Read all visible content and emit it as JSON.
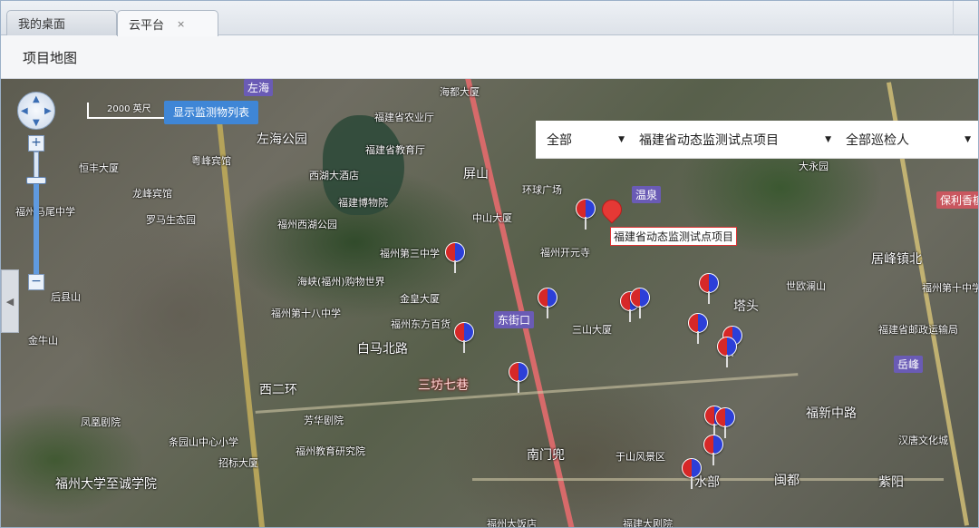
{
  "tabs": [
    {
      "label": "我的桌面"
    },
    {
      "label": "云平台",
      "close": "×"
    }
  ],
  "page": {
    "title": "项目地图"
  },
  "map": {
    "scale_label": "2000 英尺",
    "list_button": "显示监测物列表",
    "filters": {
      "status": "全部",
      "project": "福建省动态监测试点项目",
      "inspector": "全部巡检人"
    },
    "project_label": "福建省动态监测试点项目",
    "places": [
      "左海",
      "左海公园",
      "西湖大酒店",
      "福建博物院",
      "福州西湖公园",
      "福州第三中学",
      "屏山",
      "环球广场",
      "中山大厦",
      "福州开元寺",
      "温泉",
      "海都大厦",
      "福建省农业厅",
      "福建省教育厅",
      "海峡(福州)购物世界",
      "福州第十八中学",
      "金皇大厦",
      "福州东方百货",
      "东街口",
      "三山大厦",
      "白马北路",
      "西二环",
      "三坊七巷",
      "芳华剧院",
      "福州教育研究院",
      "南门兜",
      "于山风景区",
      "水部",
      "闽都",
      "紫阳",
      "塔头",
      "世欧澜山",
      "居峰镇北",
      "福州第十中学",
      "福建省邮政运输局",
      "岳峰",
      "福新中路",
      "汉唐文化城",
      "福州大学至诚学院",
      "金牛山",
      "后县山",
      "招标大厦",
      "条园山中心小学",
      "凤凰剧院",
      "恒丰大厦",
      "龙峰宾馆",
      "罗马生态园",
      "粤峰宾馆",
      "福州马尾中学",
      "大永园",
      "保利香槟",
      "福州大饭店",
      "福建大剧院"
    ]
  },
  "colors": {
    "accent": "#3f86d6",
    "pin_red": "#d62828",
    "pin_blue": "#2c3fd8"
  }
}
